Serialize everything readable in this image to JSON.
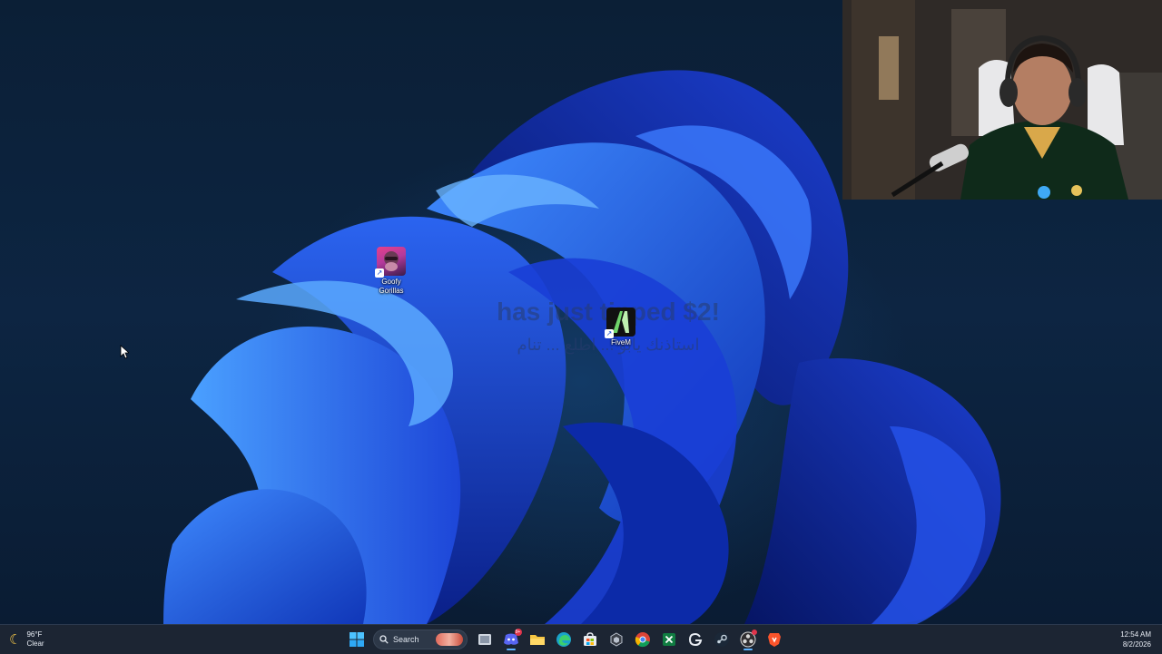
{
  "desktop": {
    "icons": [
      {
        "label_line1": "Goofy",
        "label_line2": "Gorillas"
      },
      {
        "label_line1": "FiveM"
      }
    ],
    "overlay_text": "has just tipped $2!",
    "overlay_arabic": "استاذنك يابو ... اطلع ... تنام"
  },
  "taskbar": {
    "weather": {
      "temp": "96°F",
      "condition": "Clear"
    },
    "search_label": "Search",
    "discord_badge": "9+",
    "clock": {
      "time": "12:54 AM",
      "date": "8/2/2026"
    }
  },
  "colors": {
    "accent": "#5fb2ff",
    "taskbar_bg": "#1c2533",
    "wallpaper_blue": "#2a5cff"
  }
}
